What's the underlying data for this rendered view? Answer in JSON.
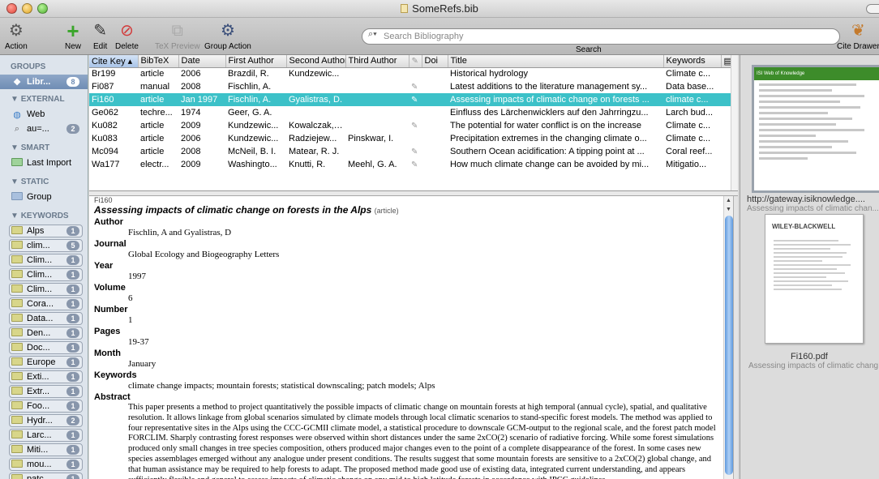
{
  "window": {
    "title": "SomeRefs.bib"
  },
  "toolbar": {
    "action": "Action",
    "new": "New",
    "edit": "Edit",
    "delete": "Delete",
    "tex_preview": "TeX Preview",
    "group_action": "Group Action",
    "search_placeholder": "Search Bibliography",
    "search_label": "Search",
    "cite_drawer": "Cite Drawer"
  },
  "sidebar": {
    "groups_header": "GROUPS",
    "library": {
      "name": "Libr...",
      "count": "8"
    },
    "external_header": "EXTERNAL",
    "external": [
      {
        "name": "Web",
        "count": ""
      },
      {
        "name": "au=...",
        "count": "2"
      }
    ],
    "smart_header": "SMART",
    "smart": [
      {
        "name": "Last Import"
      }
    ],
    "static_header": "STATIC",
    "static": [
      {
        "name": "Group"
      }
    ],
    "keywords_header": "KEYWORDS",
    "keywords": [
      {
        "name": "Alps",
        "count": "1"
      },
      {
        "name": "clim...",
        "count": "5"
      },
      {
        "name": "Clim...",
        "count": "1"
      },
      {
        "name": "Clim...",
        "count": "1"
      },
      {
        "name": "Clim...",
        "count": "1"
      },
      {
        "name": "Cora...",
        "count": "1"
      },
      {
        "name": "Data...",
        "count": "1"
      },
      {
        "name": "Den...",
        "count": "1"
      },
      {
        "name": "Doc...",
        "count": "1"
      },
      {
        "name": "Europe",
        "count": "1"
      },
      {
        "name": "Exti...",
        "count": "1"
      },
      {
        "name": "Extr...",
        "count": "1"
      },
      {
        "name": "Foo...",
        "count": "1"
      },
      {
        "name": "Hydr...",
        "count": "2"
      },
      {
        "name": "Larc...",
        "count": "1"
      },
      {
        "name": "Miti...",
        "count": "1"
      },
      {
        "name": "mou...",
        "count": "1"
      },
      {
        "name": "patc...",
        "count": "1"
      }
    ]
  },
  "table": {
    "columns": [
      "Cite Key",
      "BibTeX",
      "Date",
      "First Author",
      "Second Author",
      "Third Author",
      "",
      "Doi",
      "Title",
      "Keywords"
    ],
    "rows": [
      {
        "key": "Br199",
        "type": "article",
        "date": "2006",
        "a1": "Brazdil, R.",
        "a2": "Kundzewic...",
        "a3": "",
        "clip": "",
        "doi": "",
        "title": "Historical hydrology",
        "kw": "Climate c..."
      },
      {
        "key": "Fi087",
        "type": "manual",
        "date": "2008",
        "a1": "Fischlin, A.",
        "a2": "",
        "a3": "",
        "clip": "✎",
        "doi": "",
        "title": "Latest additions to the literature management sy...",
        "kw": "Data base..."
      },
      {
        "key": "Fi160",
        "type": "article",
        "date": "Jan 1997",
        "a1": "Fischlin, A.",
        "a2": "Gyalistras, D.",
        "a3": "",
        "clip": "✎",
        "doi": "",
        "title": "Assessing impacts of climatic change on forests ...",
        "kw": "climate c..."
      },
      {
        "key": "Ge062",
        "type": "techre...",
        "date": "1974",
        "a1": "Geer, G. A.",
        "a2": "",
        "a3": "",
        "clip": "",
        "doi": "",
        "title": "Einfluss des Lärchenwicklers auf den Jahrringzu...",
        "kw": "Larch bud..."
      },
      {
        "key": "Ku082",
        "type": "article",
        "date": "2009",
        "a1": "Kundzewic...",
        "a2": "Kowalczak, P.",
        "a3": "",
        "clip": "✎",
        "doi": "",
        "title": "The potential for water conflict is on the increase",
        "kw": "Climate c..."
      },
      {
        "key": "Ku083",
        "type": "article",
        "date": "2006",
        "a1": "Kundzewic...",
        "a2": "Radziejew...",
        "a3": "Pinskwar, I.",
        "clip": "",
        "doi": "",
        "title": "Precipitation extremes in the changing climate o...",
        "kw": "Climate c..."
      },
      {
        "key": "Mc094",
        "type": "article",
        "date": "2008",
        "a1": "McNeil, B. I.",
        "a2": "Matear, R. J.",
        "a3": "",
        "clip": "✎",
        "doi": "",
        "title": "Southern Ocean acidification: A tipping point at ...",
        "kw": "Coral reef..."
      },
      {
        "key": "Wa177",
        "type": "electr...",
        "date": "2009",
        "a1": "Washingto...",
        "a2": "Knutti, R.",
        "a3": "Meehl, G. A.",
        "clip": "✎",
        "doi": "",
        "title": "How much climate change can be avoided by mi...",
        "kw": "Mitigatio..."
      }
    ]
  },
  "detail": {
    "cite_key": "Fi160",
    "title": "Assessing impacts of climatic change on forests in the Alps",
    "type": "(article)",
    "fields": [
      {
        "label": "Author",
        "value": "Fischlin, A and Gyalistras, D"
      },
      {
        "label": "Journal",
        "value": "Global Ecology and Biogeography Letters"
      },
      {
        "label": "Year",
        "value": "1997"
      },
      {
        "label": "Volume",
        "value": "6"
      },
      {
        "label": "Number",
        "value": "1"
      },
      {
        "label": "Pages",
        "value": "19-37"
      },
      {
        "label": "Month",
        "value": "January"
      },
      {
        "label": "Keywords",
        "value": "climate change impacts; mountain forests; statistical downscaling; patch models; Alps"
      }
    ],
    "abstract_label": "Abstract",
    "abstract": "This paper presents a method to project quantitatively the possible impacts of climatic change on mountain forests at high temporal (annual cycle), spatial, and qualitative resolution. It allows linkage from global scenarios simulated by climate models through local climatic scenarios to stand-specific forest models. The method was applied to four representative sites in the Alps using the CCC-GCMII climate model, a statistical procedure to downscale GCM-output to the regional scale, and the forest patch model FORCLIM. Sharply contrasting forest responses were observed within short distances under the same 2xCO(2) scenario of radiative forcing. While some forest simulations produced only small changes in tree species composition, others produced major changes even to the point of a complete disappearance of the forest. In some cases new species assemblages emerged without any analogue under present conditions. The results suggest that some mountain forests are sensitive to a 2xCO(2) global change, and that human assistance may be required to help forests to adapt. The proposed method made good use of existing data, integrated current understanding, and appears sufficiently flexible and general to assess impacts of climatic change on any mid to high latitude forests in accordance with IPCC guidelines."
  },
  "drawer": {
    "item1_caption": "http://gateway.isiknowledge....",
    "item1_sub": "Assessing impacts of climatic chan...",
    "thumb1_text": "ISI Web of Knowledge",
    "item2_caption": "Fi160.pdf",
    "item2_sub": "Assessing impacts of climatic chang...",
    "thumb2_text": "WILEY-BLACKWELL"
  }
}
